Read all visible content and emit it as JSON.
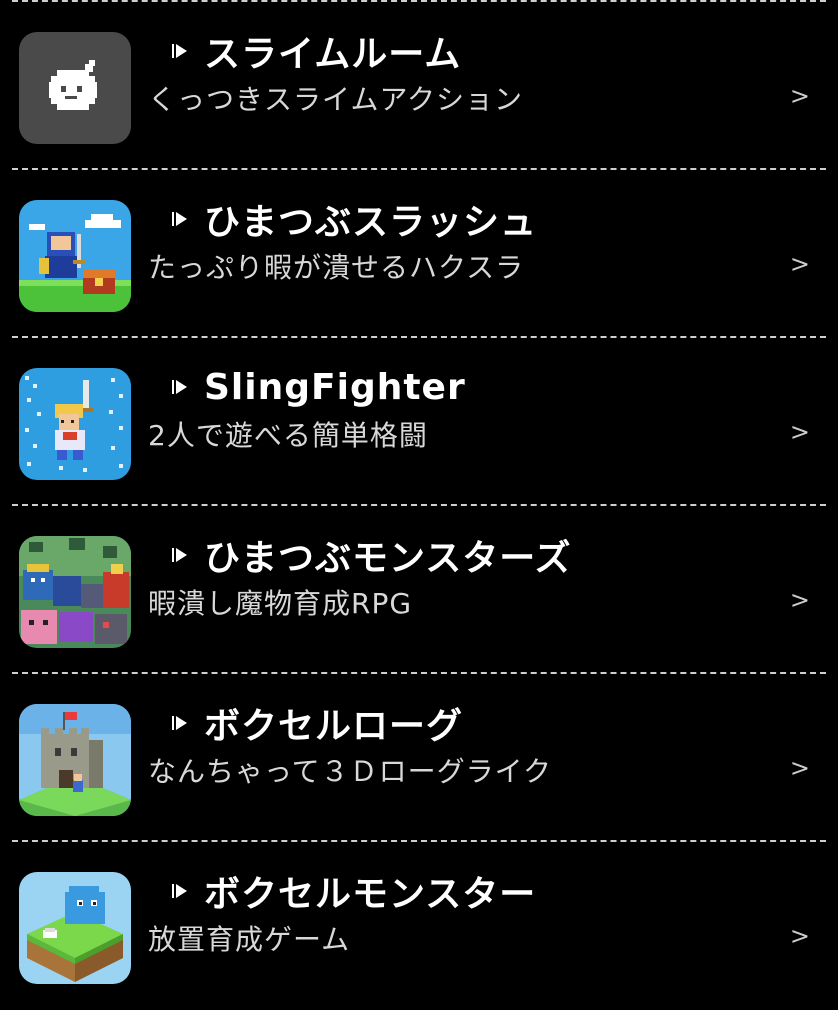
{
  "apps": [
    {
      "title": "スライムルーム",
      "subtitle": "くっつきスライムアクション",
      "chevron": ">",
      "icon": "slime-room-icon"
    },
    {
      "title": "ひまつぶスラッシュ",
      "subtitle": "たっぷり暇が潰せるハクスラ",
      "chevron": ">",
      "icon": "himatsubu-slash-icon"
    },
    {
      "title": "SlingFighter",
      "subtitle": "2人で遊べる簡単格闘",
      "chevron": ">",
      "icon": "slingfighter-icon"
    },
    {
      "title": "ひまつぶモンスターズ",
      "subtitle": "暇潰し魔物育成RPG",
      "chevron": ">",
      "icon": "himatsubu-monsters-icon"
    },
    {
      "title": "ボクセルローグ",
      "subtitle": "なんちゃって３Ｄローグライク",
      "chevron": ">",
      "icon": "voxel-rogue-icon"
    },
    {
      "title": "ボクセルモンスター",
      "subtitle": "放置育成ゲーム",
      "chevron": ">",
      "icon": "voxel-monster-icon"
    }
  ],
  "colors": {
    "background": "#000000",
    "text": "#ffffff",
    "subtext": "#d8d8d8",
    "divider": "#cfcfcf"
  }
}
